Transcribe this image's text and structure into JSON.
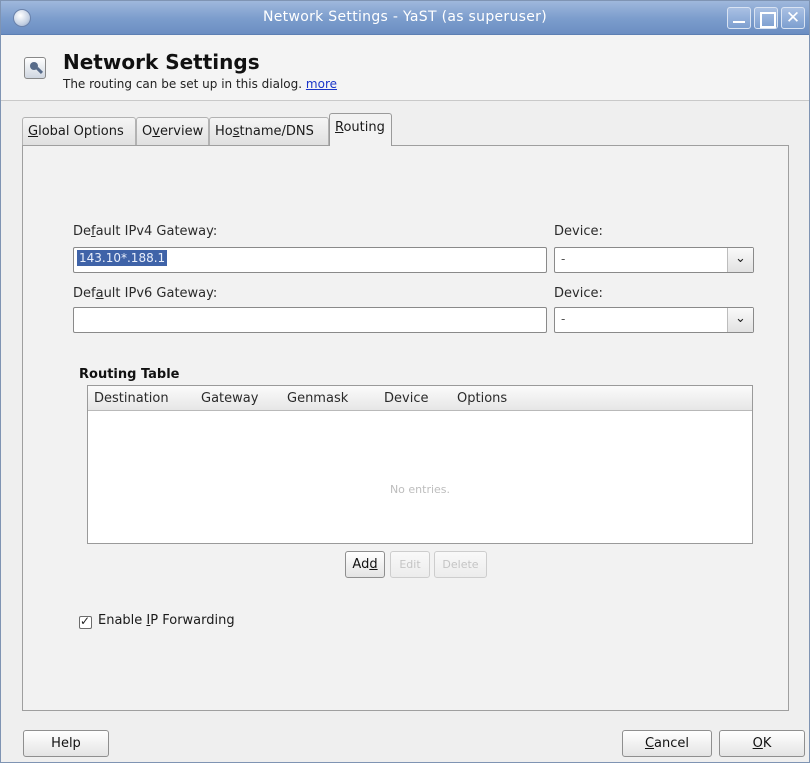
{
  "window": {
    "title": "Network Settings - YaST (as superuser)"
  },
  "header": {
    "title": "Network Settings",
    "subtitle": "The routing can be set up in this dialog.",
    "more_link": "more"
  },
  "tabs": [
    {
      "pre": "",
      "u": "G",
      "post": "lobal Options"
    },
    {
      "pre": "O",
      "u": "v",
      "post": "erview"
    },
    {
      "pre": "Ho",
      "u": "s",
      "post": "tname/DNS"
    },
    {
      "pre": "",
      "u": "R",
      "post": "outing"
    }
  ],
  "routing": {
    "ipv4_label": {
      "pre": "De",
      "u": "f",
      "post": "ault IPv4 Gateway:"
    },
    "ipv4_value": "143.10*.188.1",
    "ipv4_device_label": "Device:",
    "ipv4_device_value": "-",
    "ipv6_label": {
      "pre": "Def",
      "u": "a",
      "post": "ult IPv6 Gateway:"
    },
    "ipv6_value": "",
    "ipv6_device_label": "Device:",
    "ipv6_device_value": "-"
  },
  "routing_table": {
    "title": "Routing Table",
    "columns": [
      "Destination",
      "Gateway",
      "Genmask",
      "Device",
      "Options"
    ],
    "empty_text": "No entries."
  },
  "table_buttons": {
    "add": {
      "pre": "Ad",
      "u": "d",
      "post": ""
    },
    "edit": "Edit",
    "delete": "Delete"
  },
  "forwarding": {
    "checked": true,
    "label": {
      "pre": "Enable ",
      "u": "I",
      "post": "P Forwarding"
    }
  },
  "footer": {
    "help": "Help",
    "cancel": {
      "pre": "",
      "u": "C",
      "post": "ancel"
    },
    "ok": {
      "pre": "",
      "u": "O",
      "post": "K"
    }
  },
  "colors": {
    "titlebar": "#7b9ccc",
    "selection": "#3f63a8",
    "link": "#1a35c9"
  }
}
